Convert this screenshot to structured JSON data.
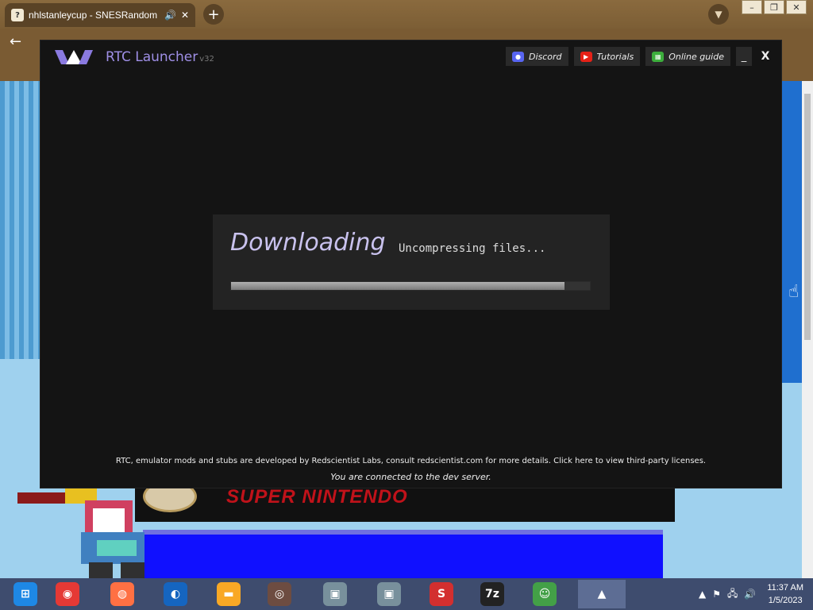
{
  "browser": {
    "tab_title": "nhlstanleycup - SNESRandom",
    "tab_icon": "puzzle-favicon-icon"
  },
  "launcher": {
    "app_name": "RTC Launcher",
    "version": "v32",
    "buttons": {
      "discord": "Discord",
      "tutorials": "Tutorials",
      "guide": "Online guide",
      "minimize": "_",
      "close": "X"
    },
    "download": {
      "title": "Downloading",
      "status": "Uncompressing files...",
      "progress_fraction": 0.93
    },
    "footer": {
      "credits": "RTC, emulator mods and stubs are developed by Redscientist Labs, consult redscientist.com for more details. Click here to view third-party licenses.",
      "connection": "You are connected to the dev server."
    },
    "colors": {
      "accent": "#9f8fe6",
      "panel": "#232323",
      "background": "#141414"
    }
  },
  "taskbar": {
    "apps": [
      {
        "name": "start-button",
        "icon": "windows-start-icon",
        "color": "#1e88e5"
      },
      {
        "name": "chrome",
        "icon": "chrome-icon",
        "color": "#e53935"
      },
      {
        "name": "firefox",
        "icon": "firefox-icon",
        "color": "#ff7043"
      },
      {
        "name": "obama-app",
        "icon": "obama-logo-icon",
        "color": "#1565c0"
      },
      {
        "name": "file-explorer",
        "icon": "folder-icon",
        "color": "#f9a825"
      },
      {
        "name": "sushi-app",
        "icon": "sushi-icon",
        "color": "#6d4c41"
      },
      {
        "name": "setup-1",
        "icon": "installer-icon",
        "color": "#78909c"
      },
      {
        "name": "setup-2",
        "icon": "installer-icon",
        "color": "#78909c"
      },
      {
        "name": "snes9x",
        "icon": "s-logo-icon",
        "color": "#d32f2f"
      },
      {
        "name": "7zip",
        "icon": "7z-icon",
        "color": "#222222"
      },
      {
        "name": "users-app",
        "icon": "users-icon",
        "color": "#43a047"
      },
      {
        "name": "rtc-launcher",
        "icon": "rtc-logo-icon",
        "color": "#5d6d94"
      }
    ],
    "clock_time": "11:37 AM",
    "clock_date": "1/5/2023"
  }
}
